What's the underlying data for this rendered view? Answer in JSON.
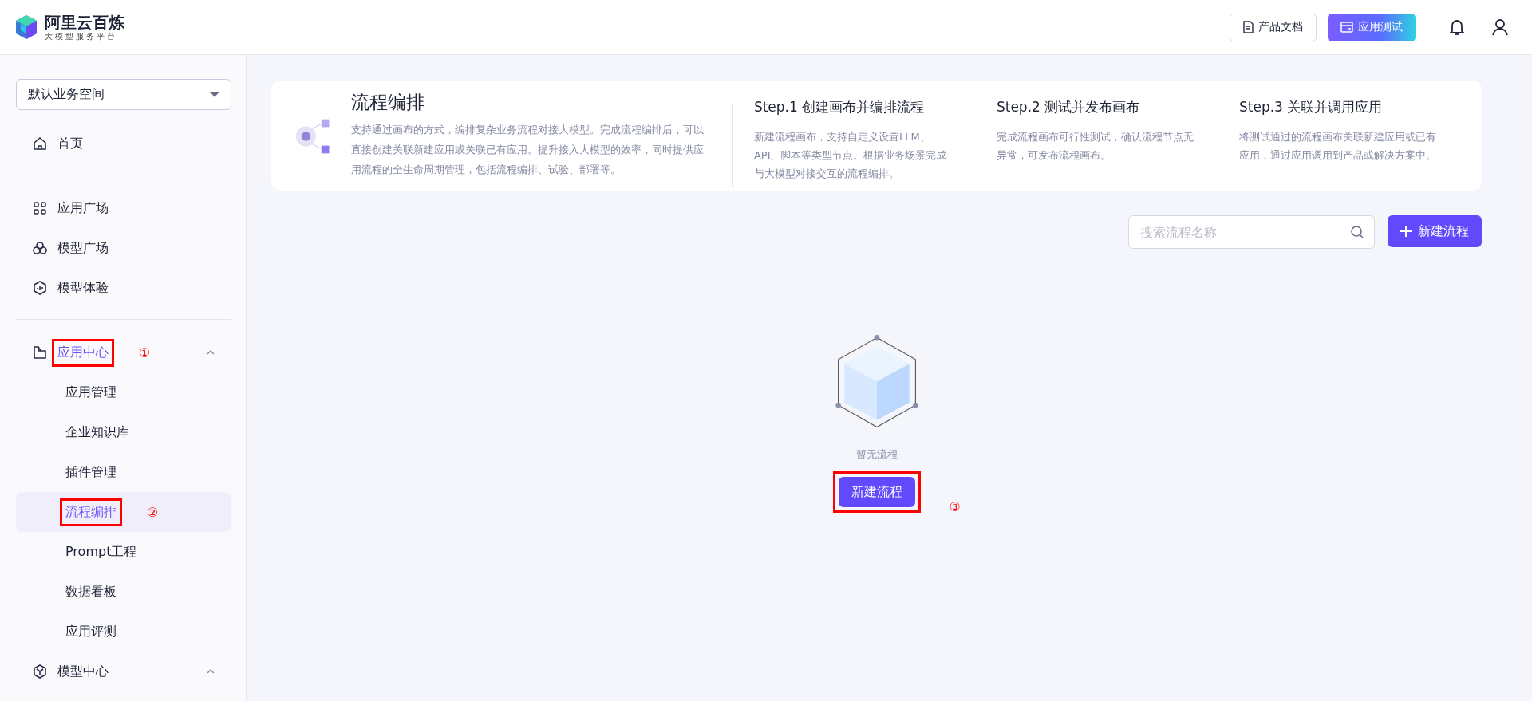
{
  "header": {
    "brand": {
      "name": "阿里云百炼",
      "tagline": "大模型服务平台"
    },
    "buttons": [
      {
        "kind": "doc",
        "label": "产品文档"
      },
      {
        "kind": "test",
        "label": "应用测试"
      }
    ]
  },
  "sidebar": {
    "workspace": "默认业务空间",
    "sections": [
      {
        "items": [
          {
            "kind": "home",
            "label": "首页",
            "selected": false
          }
        ]
      },
      {
        "items": [
          {
            "kind": "grid",
            "label": "应用广场",
            "selected": false
          },
          {
            "kind": "model",
            "label": "模型广场",
            "selected": false
          },
          {
            "kind": "chart",
            "label": "模型体验",
            "selected": false
          }
        ]
      },
      {
        "items": [
          {
            "kind": "folder",
            "label": "应用中心",
            "selected": true,
            "expanded": true,
            "annotation": "①",
            "children": [
              {
                "label": "应用管理",
                "selected": false
              },
              {
                "label": "企业知识库",
                "selected": false
              },
              {
                "label": "插件管理",
                "selected": false
              },
              {
                "label": "流程编排",
                "selected": true,
                "annotation": "②"
              },
              {
                "label": "Prompt工程",
                "selected": false
              },
              {
                "label": "数据看板",
                "selected": false
              },
              {
                "label": "应用评测",
                "selected": false
              }
            ]
          },
          {
            "kind": "cube",
            "label": "模型中心",
            "selected": false,
            "expanded": true
          }
        ]
      }
    ]
  },
  "intro": {
    "title": "流程编排",
    "description": "支持通过画布的方式，编排复杂业务流程对接大模型。完成流程编排后，可以直接创建关联新建应用或关联已有应用。提升接入大模型的效率，同时提供应用流程的全生命周期管理，包括流程编排、试验、部署等。",
    "steps": [
      {
        "title": "Step.1 创建画布并编排流程",
        "text": "新建流程画布，支持自定义设置LLM、API、脚本等类型节点。根据业务场景完成与大模型对接交互的流程编排。"
      },
      {
        "title": "Step.2 测试并发布画布",
        "text": "完成流程画布可行性测试，确认流程节点无异常，可发布流程画布。"
      },
      {
        "title": "Step.3 关联并调用应用",
        "text": "将测试通过的流程画布关联新建应用或已有应用，通过应用调用到产品或解决方案中。"
      }
    ]
  },
  "toolbar": {
    "search": {
      "placeholder": "搜索流程名称"
    },
    "new_button": "新建流程"
  },
  "empty_state": {
    "message": "暂无流程",
    "button": "新建流程",
    "annotation": "③"
  }
}
